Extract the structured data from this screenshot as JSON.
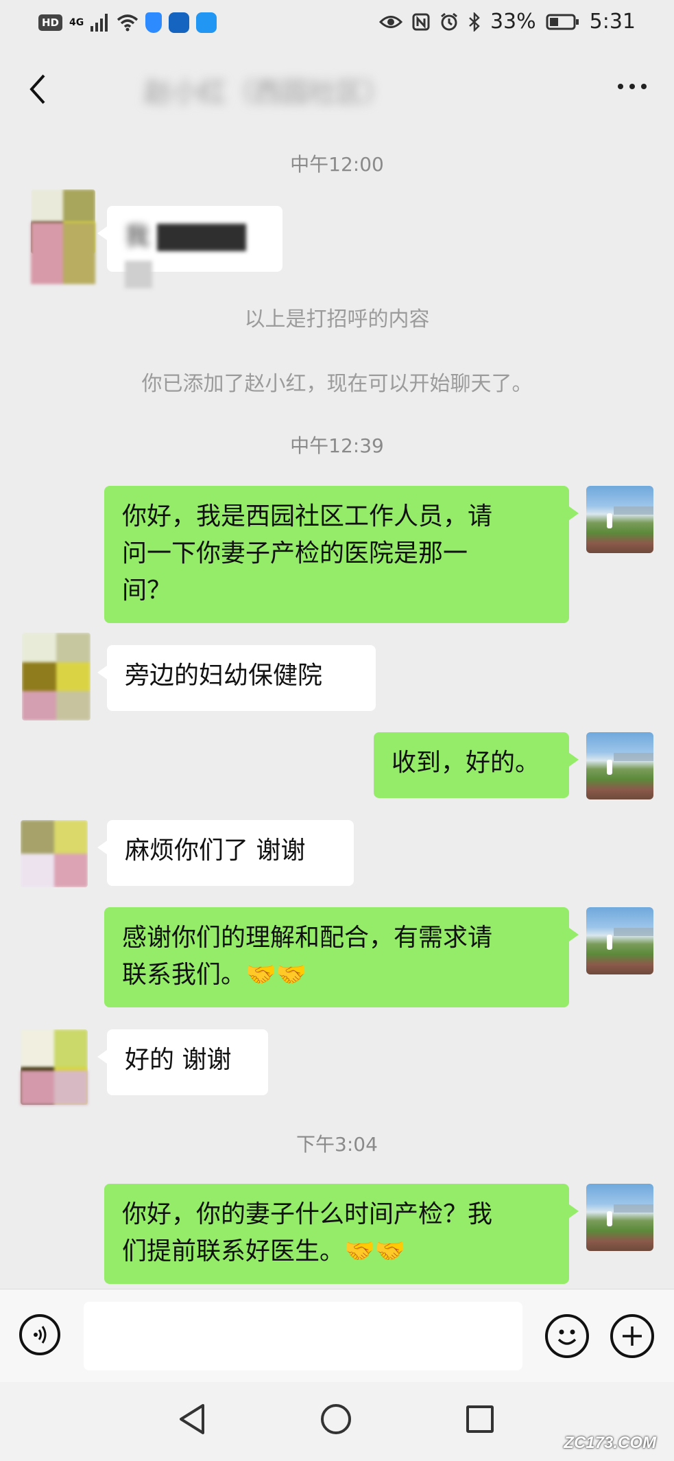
{
  "status_bar": {
    "hd": "HD",
    "network": "4G",
    "battery": "33%",
    "time": "5:31",
    "icons": [
      "signal-icon",
      "wifi-icon",
      "shield-icon",
      "bulb-app-icon",
      "weather-app-icon",
      "eye-icon",
      "nfc-icon",
      "alarm-icon",
      "bluetooth-icon",
      "battery-icon"
    ]
  },
  "header": {
    "title": "赵小红（西园社区）"
  },
  "chat": {
    "times": [
      "中午12:00",
      "中午12:39",
      "下午3:04"
    ],
    "system": [
      "以上是打招呼的内容",
      "你已添加了赵小红，现在可以开始聊天了。"
    ],
    "greeting_prefix": "我",
    "messages": [
      {
        "side": "right",
        "text_lines": [
          "你好，我是西园社区工作人员，请",
          "问一下你妻子产检的医院是那一",
          "间？"
        ]
      },
      {
        "side": "left",
        "text": "旁边的妇幼保健院"
      },
      {
        "side": "right",
        "text": "收到，好的。"
      },
      {
        "side": "left",
        "text": "麻烦你们了 谢谢"
      },
      {
        "side": "right",
        "text_lines": [
          "感谢你们的理解和配合，有需求请",
          "联系我们。"
        ],
        "emoji": "🤝🤝"
      },
      {
        "side": "left",
        "text": "好的 谢谢"
      },
      {
        "side": "right",
        "text_lines": [
          "你好，你的妻子什么时间产检？我",
          "们提前联系好医生。"
        ],
        "emoji": "🤝🤝"
      }
    ]
  },
  "input": {
    "placeholder": ""
  },
  "watermark": "ZC173.COM",
  "colors": {
    "background": "#ededed",
    "my_bubble": "#95ec69",
    "other_bubble": "#ffffff"
  }
}
